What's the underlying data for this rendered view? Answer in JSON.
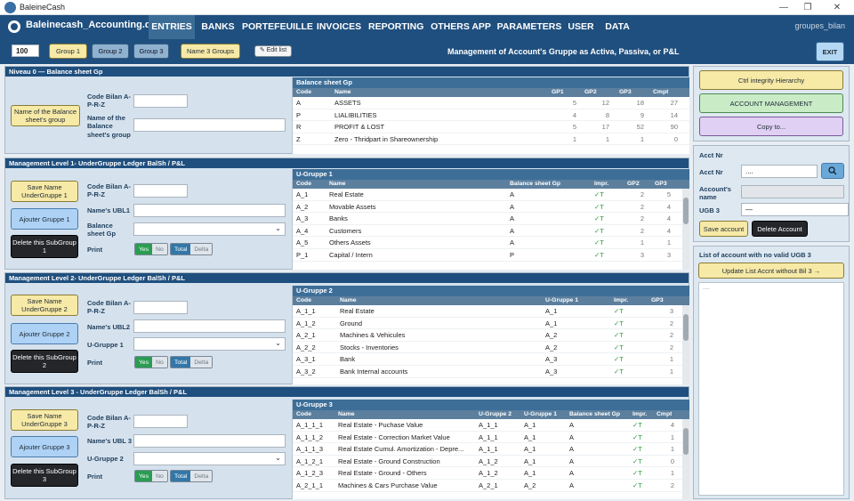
{
  "window": {
    "title": "BaleineCash"
  },
  "menu": {
    "db_name": "Baleinecash_Accounting.db",
    "items": [
      "ENTRIES",
      "BANKS",
      "PORTEFEUILLE",
      "INVOICES",
      "REPORTING",
      "OTHERS APP",
      "PARAMETERS",
      "USER",
      "DATA"
    ],
    "user": "groupes_bilan"
  },
  "toolbar": {
    "count": "100",
    "group1": "Group 1",
    "group2": "Group 2",
    "group3": "Group 3",
    "name3groups": "Name 3 Groups",
    "edit_list": "✎ Edit list",
    "title": "Management of Account's Gruppe as Activa, Passiva, or P&L",
    "exit": "EXIT"
  },
  "niveau0": {
    "header": "Niveau 0 — Balance sheet Gp",
    "name_btn": "Name of the Balance sheet's group",
    "lbl_code": "Code Bilan A-P-R-Z",
    "lbl_name": "Name of the Balance sheet's group",
    "table_title": "Balance sheet Gp",
    "cols": [
      "Code",
      "Name",
      "GP1",
      "GP2",
      "GP3",
      "Cmpt"
    ],
    "rows": [
      [
        "A",
        "ASSETS",
        "5",
        "12",
        "18",
        "27"
      ],
      [
        "P",
        "LIALIBILITIES",
        "4",
        "8",
        "9",
        "14"
      ],
      [
        "R",
        "PROFIT & LOST",
        "5",
        "17",
        "52",
        "90"
      ],
      [
        "Z",
        "Zero - Thridpart in Shareownership",
        "1",
        "1",
        "1",
        "0"
      ]
    ]
  },
  "level1": {
    "header": "Management Level 1- UnderGruppe Ledger BalSh / P&L",
    "save_btn": "Save Name UnderGruppe 1",
    "add_btn": "Ajouter Gruppe 1",
    "del_btn": "Delete this SubGroup 1",
    "lbl_code": "Code Bilan A-P-R-Z",
    "lbl_name": "Name's UBL1",
    "lbl_gp": "Balance sheet Gp",
    "lbl_print": "Print",
    "yes": "Yes",
    "no": "No",
    "total": "Total",
    "delta": "Delta",
    "table_title": "U-Gruppe 1",
    "cols": [
      "Code",
      "Name",
      "Balance sheet Gp",
      "Impr.",
      "GP2",
      "GP3"
    ],
    "rows": [
      [
        "A_1",
        "Real Estate",
        "A",
        "✓T",
        "2",
        "5"
      ],
      [
        "A_2",
        "Movable Assets",
        "A",
        "✓T",
        "2",
        "4"
      ],
      [
        "A_3",
        "Banks",
        "A",
        "✓T",
        "2",
        "4"
      ],
      [
        "A_4",
        "Customers",
        "A",
        "✓T",
        "2",
        "4"
      ],
      [
        "A_5",
        "Others Assets",
        "A",
        "✓T",
        "1",
        "1"
      ],
      [
        "P_1",
        "Capital / Intern",
        "P",
        "✓T",
        "3",
        "3"
      ]
    ]
  },
  "level2": {
    "header": "Management Level 2- UnderGruppe Ledger BalSh / P&L",
    "save_btn": "Save Name UnderGruppe 2",
    "add_btn": "Ajouter Gruppe 2",
    "del_btn": "Delete this SubGroup 2",
    "lbl_code": "Code Bilan A-P-R-Z",
    "lbl_name": "Name's UBL2",
    "lbl_gp": "U-Gruppe 1",
    "lbl_print": "Print",
    "yes": "Yes",
    "no": "No",
    "total": "Total",
    "delta": "Delta",
    "table_title": "U-Gruppe 2",
    "cols": [
      "Code",
      "Name",
      "U-Gruppe 1",
      "Impr.",
      "GP3"
    ],
    "rows": [
      [
        "A_1_1",
        "Real Estate",
        "A_1",
        "✓T",
        "3"
      ],
      [
        "A_1_2",
        "Ground",
        "A_1",
        "✓T",
        "2"
      ],
      [
        "A_2_1",
        "Machines & Vehicules",
        "A_2",
        "✓T",
        "2"
      ],
      [
        "A_2_2",
        "Stocks - Inventories",
        "A_2",
        "✓T",
        "2"
      ],
      [
        "A_3_1",
        "Bank",
        "A_3",
        "✓T",
        "1"
      ],
      [
        "A_3_2",
        "Bank Internal accounts",
        "A_3",
        "✓T",
        "1"
      ]
    ]
  },
  "level3": {
    "header": "Management Level 3 - UnderGruppe Ledger BalSh / P&L",
    "save_btn": "Save Name UnderGruppe 3",
    "add_btn": "Ajouter Gruppe 3",
    "del_btn": "Delete this SubGroup 3",
    "lbl_code": "Code Bilan A-P-R-Z",
    "lbl_name": "Name's UBL 3",
    "lbl_gp": "U-Gruppe 2",
    "lbl_print": "Print",
    "yes": "Yes",
    "no": "No",
    "total": "Total",
    "delta": "Delta",
    "table_title": "U-Gruppe 3",
    "cols": [
      "Code",
      "Name",
      "U-Gruppe 2",
      "U-Gruppe 1",
      "Balance sheet Gp",
      "Impr.",
      "Cmpt"
    ],
    "rows": [
      [
        "A_1_1_1",
        "Real Estate - Puchase Value",
        "A_1_1",
        "A_1",
        "A",
        "✓T",
        "4"
      ],
      [
        "A_1_1_2",
        "Real Estate - Correction Market Value",
        "A_1_1",
        "A_1",
        "A",
        "✓T",
        "1"
      ],
      [
        "A_1_1_3",
        "Real Estate Cumul. Amortization - Depre...",
        "A_1_1",
        "A_1",
        "A",
        "✓T",
        "1"
      ],
      [
        "A_1_2_1",
        "Real Estate - Ground Construction",
        "A_1_2",
        "A_1",
        "A",
        "✓T",
        "0"
      ],
      [
        "A_1_2_3",
        "Real Estate - Ground - Others",
        "A_1_2",
        "A_1",
        "A",
        "✓T",
        "1"
      ],
      [
        "A_2_1_1",
        "Machines & Cars Purchase Value",
        "A_2_1",
        "A_2",
        "A",
        "✓T",
        "2"
      ]
    ]
  },
  "side": {
    "ctrl_btn": "Ctrl integrity Hierarchy",
    "acct_btn": "ACCOUNT MANAGEMENT",
    "copy_btn": "Copy to...",
    "acct_title": "Acct Nr",
    "lbl_acct": "Acct Nr",
    "acct_value": "....",
    "lbl_acct_name": "Account's name",
    "lbl_ugb3": "UGB 3",
    "ugb3_value": "—",
    "save_acct": "Save account",
    "del_acct": "Delete Account",
    "list_title": "List of account with no valid UGB 3",
    "update_btn": "Update List Accnt without Bil 3 →",
    "list_value": "...."
  }
}
